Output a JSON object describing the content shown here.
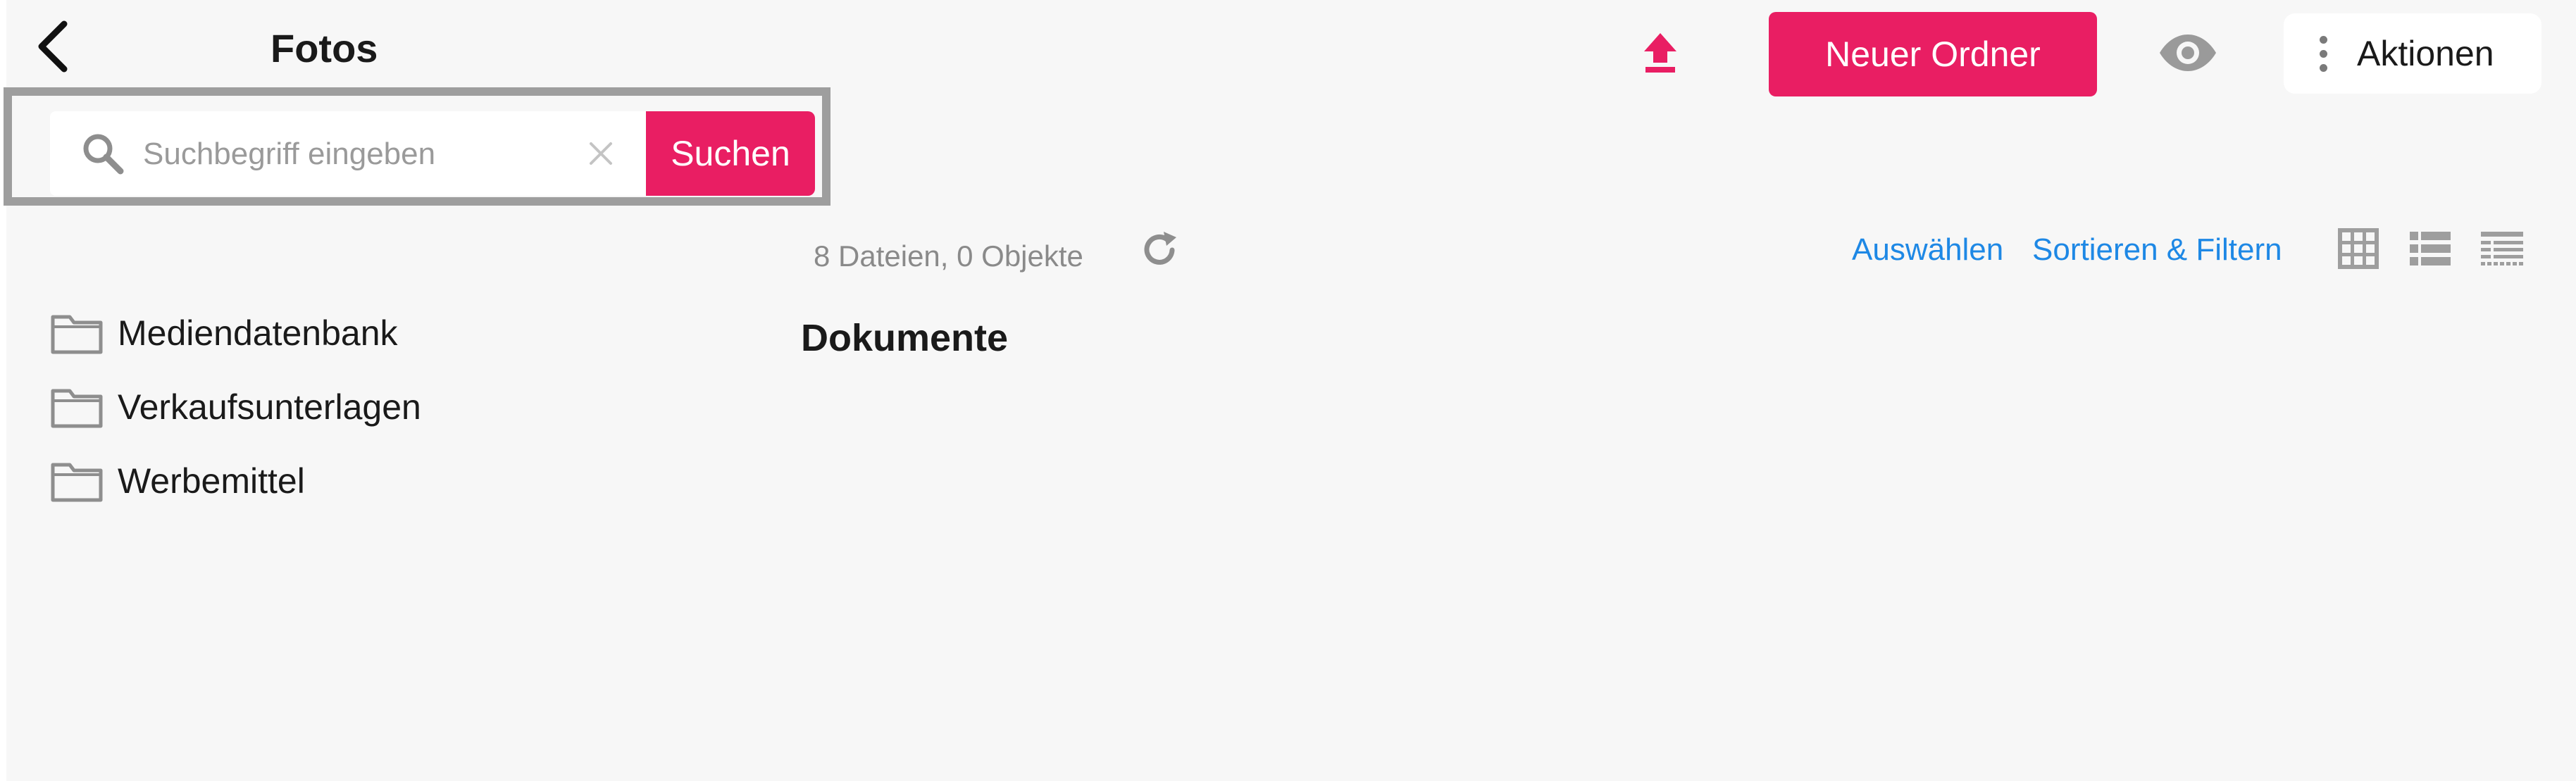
{
  "header": {
    "title": "Fotos",
    "new_folder_label": "Neuer Ordner",
    "actions_label": "Aktionen",
    "icons": [
      "chevron-left-icon",
      "upload-icon",
      "eye-icon",
      "more-vertical-icon"
    ]
  },
  "search": {
    "placeholder": "Suchbegriff eingeben",
    "value": "",
    "button_label": "Suchen",
    "icons": [
      "search-icon",
      "clear-icon"
    ]
  },
  "sidebar": {
    "folders": [
      {
        "label": "Mediendatenbank",
        "icon": "folder-icon"
      },
      {
        "label": "Verkaufsunterlagen",
        "icon": "folder-icon"
      },
      {
        "label": "Werbemittel",
        "icon": "folder-icon"
      }
    ]
  },
  "main": {
    "file_count": "8 Dateien, 0 Objekte",
    "section_title": "Dokumente",
    "select_label": "Auswählen",
    "sort_filter_label": "Sortieren & Filtern",
    "view_modes": [
      "grid-view-icon",
      "list-view-icon",
      "compact-list-view-icon"
    ]
  },
  "colors": {
    "accent": "#e91e63",
    "link": "#1e88e5",
    "icon_gray": "#8e8e8e",
    "background": "#f7f7f7",
    "search_frame": "#9e9e9e"
  }
}
